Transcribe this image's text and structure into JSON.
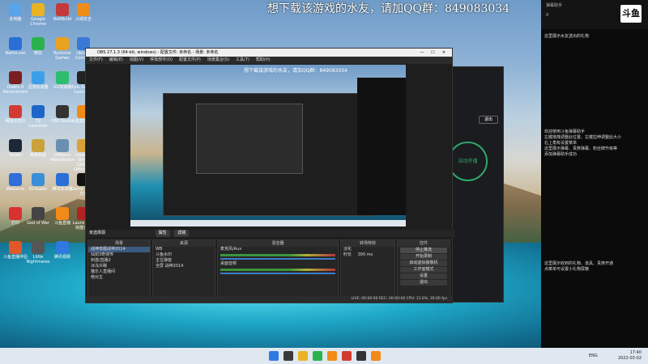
{
  "desktop": {
    "overlay_text": "想下载该游戏的水友，请加QQ群：849083034",
    "icons": [
      {
        "label": "此电脑",
        "color": "#5aa3e8"
      },
      {
        "label": "Google Chrome",
        "color": "#e9b323"
      },
      {
        "label": "RoRBuild",
        "color": "#c43a3a"
      },
      {
        "label": "火绒安全",
        "color": "#f08c1a"
      },
      {
        "label": "Battle.net",
        "color": "#2a6fd6"
      },
      {
        "label": "微信",
        "color": "#2bb24c"
      },
      {
        "label": "Rockstar Games",
        "color": "#e8a21e"
      },
      {
        "label": "Ubisoft Connect",
        "color": "#3a79d8"
      },
      {
        "label": "Diablo II Resurrected",
        "color": "#7a1f1f"
      },
      {
        "label": "迅游加速器",
        "color": "#3ca0e8"
      },
      {
        "label": "UU加速器",
        "color": "#2dbd6e"
      },
      {
        "label": "Epic Games Launcher",
        "color": "#222222"
      },
      {
        "label": "网易云音乐",
        "color": "#d33a31"
      },
      {
        "label": "TV Launcher",
        "color": "#1f66c9"
      },
      {
        "label": "OBS Studio",
        "color": "#333333"
      },
      {
        "label": "斗鱼直播伴侣",
        "color": "#f28a1a"
      },
      {
        "label": "Steam",
        "color": "#1b2838"
      },
      {
        "label": "英雄联盟",
        "color": "#c9a23a"
      },
      {
        "label": "VMware Workstation",
        "color": "#6b8fb3"
      },
      {
        "label": "Counter-Strike Global Offensive",
        "color": "#d9a13a"
      },
      {
        "label": "WeGame",
        "color": "#2f6ed8"
      },
      {
        "label": "EClouder",
        "color": "#3a8fd8"
      },
      {
        "label": "腾讯加速器",
        "color": "#2b6fd6"
      },
      {
        "label": "Game - 快捷方式",
        "color": "#111111"
      },
      {
        "label": "打印",
        "color": "#d93030"
      },
      {
        "label": "God of War",
        "color": "#444444"
      },
      {
        "label": "斗鱼直播",
        "color": "#f28a1a"
      },
      {
        "label": "Launcher - 快捷方式",
        "color": "#b02222"
      },
      {
        "label": "斗鱼直播伴侣",
        "color": "#e2572a"
      },
      {
        "label": "Little Nightmares",
        "color": "#555555"
      },
      {
        "label": "腾讯视频",
        "color": "#2f7ae0"
      }
    ]
  },
  "obs": {
    "title": "OBS 27.1.3 (64-bit, windows) - 配置文件: 未命名 - 场景: 未命名",
    "menu": [
      "文件(F)",
      "编辑(E)",
      "视图(V)",
      "停靠部件(D)",
      "配置文件(P)",
      "场景集合(S)",
      "工具(T)",
      "帮助(H)"
    ],
    "preview_text": "想下载该游戏的水友，请加QQ群：849083034",
    "scene_bar_label": "未选择源",
    "scene_bar_tags": [
      "属性",
      "滤镜"
    ],
    "panels": {
      "scenes": {
        "title": "场景",
        "items": [
          "战神兽疆战神2014",
          "仙剑3奇侠传",
          "刺激/直播2",
          "冰冻炎瞳",
          "猫乐人直播间",
          "绝对主"
        ]
      },
      "sources": {
        "title": "来源",
        "items": [
          "WB",
          "斗鱼水印",
          "主位弹窗",
          "全屏 战神2014"
        ]
      },
      "mixer": {
        "title": "混音器",
        "tracks": [
          "麦克风/Aux",
          "桌面音频"
        ]
      },
      "transitions": {
        "title": "转场特效",
        "type": "淡化",
        "duration_label": "时长",
        "duration": "300 ms"
      },
      "controls": {
        "title": "控件",
        "buttons": [
          "停止推流",
          "开始录制",
          "启动虚拟摄像机",
          "工作室模式",
          "设置",
          "退出"
        ]
      }
    },
    "status": "LIVE: 00:00:00  REC: 00:00:00  CPU: 13.0%, 30.00 fps"
  },
  "douyu_window": {
    "button": "退出",
    "start_label": "自动开播"
  },
  "chat": {
    "header_label": "弹幕助手",
    "header_count": "0",
    "messages": [
      "这里展示水友送出的礼物",
      "欢迎使用斗鱼弹幕助手\n左键拖拽调整此位置，左键拉伸调整此大小\n右上角有设置菜单\n这里展示弹幕、贵族弹幕、粉丝牌升级等\n添加弹幕助手成功",
      "这里展示收到的礼物、道具、贵族开通\n点菜单可设置小礼物屏蔽"
    ],
    "logo_text": "斗鱼"
  },
  "taskbar": {
    "lang": "ENG",
    "time": "17:40",
    "date": "2022-03-02"
  }
}
